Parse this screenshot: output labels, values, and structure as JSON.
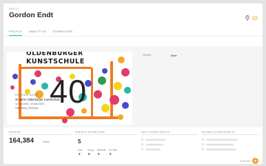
{
  "header": {
    "label": "ARTIST",
    "name": "Gordon Endt"
  },
  "tabs": [
    {
      "label": "PROFILE",
      "active": true
    },
    {
      "label": "ANALYTICS",
      "active": false
    },
    {
      "label": "EXHIBITIONS",
      "active": false
    }
  ],
  "exhibition": {
    "image_title_line1": "OLDENBURGER",
    "image_title_line2": "KUNSTSCHULE",
    "image_number": "40",
    "previous_label": "PREVIOUS SHOW",
    "title": "40 Jahre Oldenburger Kunstschule",
    "dates": "14 Oct 2024 - 10 Nov 2024",
    "location": "Oldenburg | Germany"
  },
  "profile": {
    "gender_label": "Gender",
    "gender_value": "Male"
  },
  "stats": {
    "ranking_label": "RANKING",
    "ranking_value": "164,384",
    "ranking_sub": "Global",
    "exhibitions_label": "VERIFIED EXHIBITIONS",
    "exhibitions_count": "5",
    "exhibitions_breakdown": [
      {
        "label": "Solo",
        "value": "0"
      },
      {
        "label": "Group",
        "value": "5"
      },
      {
        "label": "Biennale",
        "value": "0"
      },
      {
        "label": "Art Fairs",
        "value": "0"
      }
    ],
    "most_in_label": "MOST EXHIBITIONS IN",
    "notable_label": "NOTABLE EXHIBITIONS AT"
  },
  "footer": {
    "show_more": "Show more"
  },
  "colors": {
    "accent_teal": "#2ab6ab",
    "accent_orange": "#f3a72c"
  }
}
